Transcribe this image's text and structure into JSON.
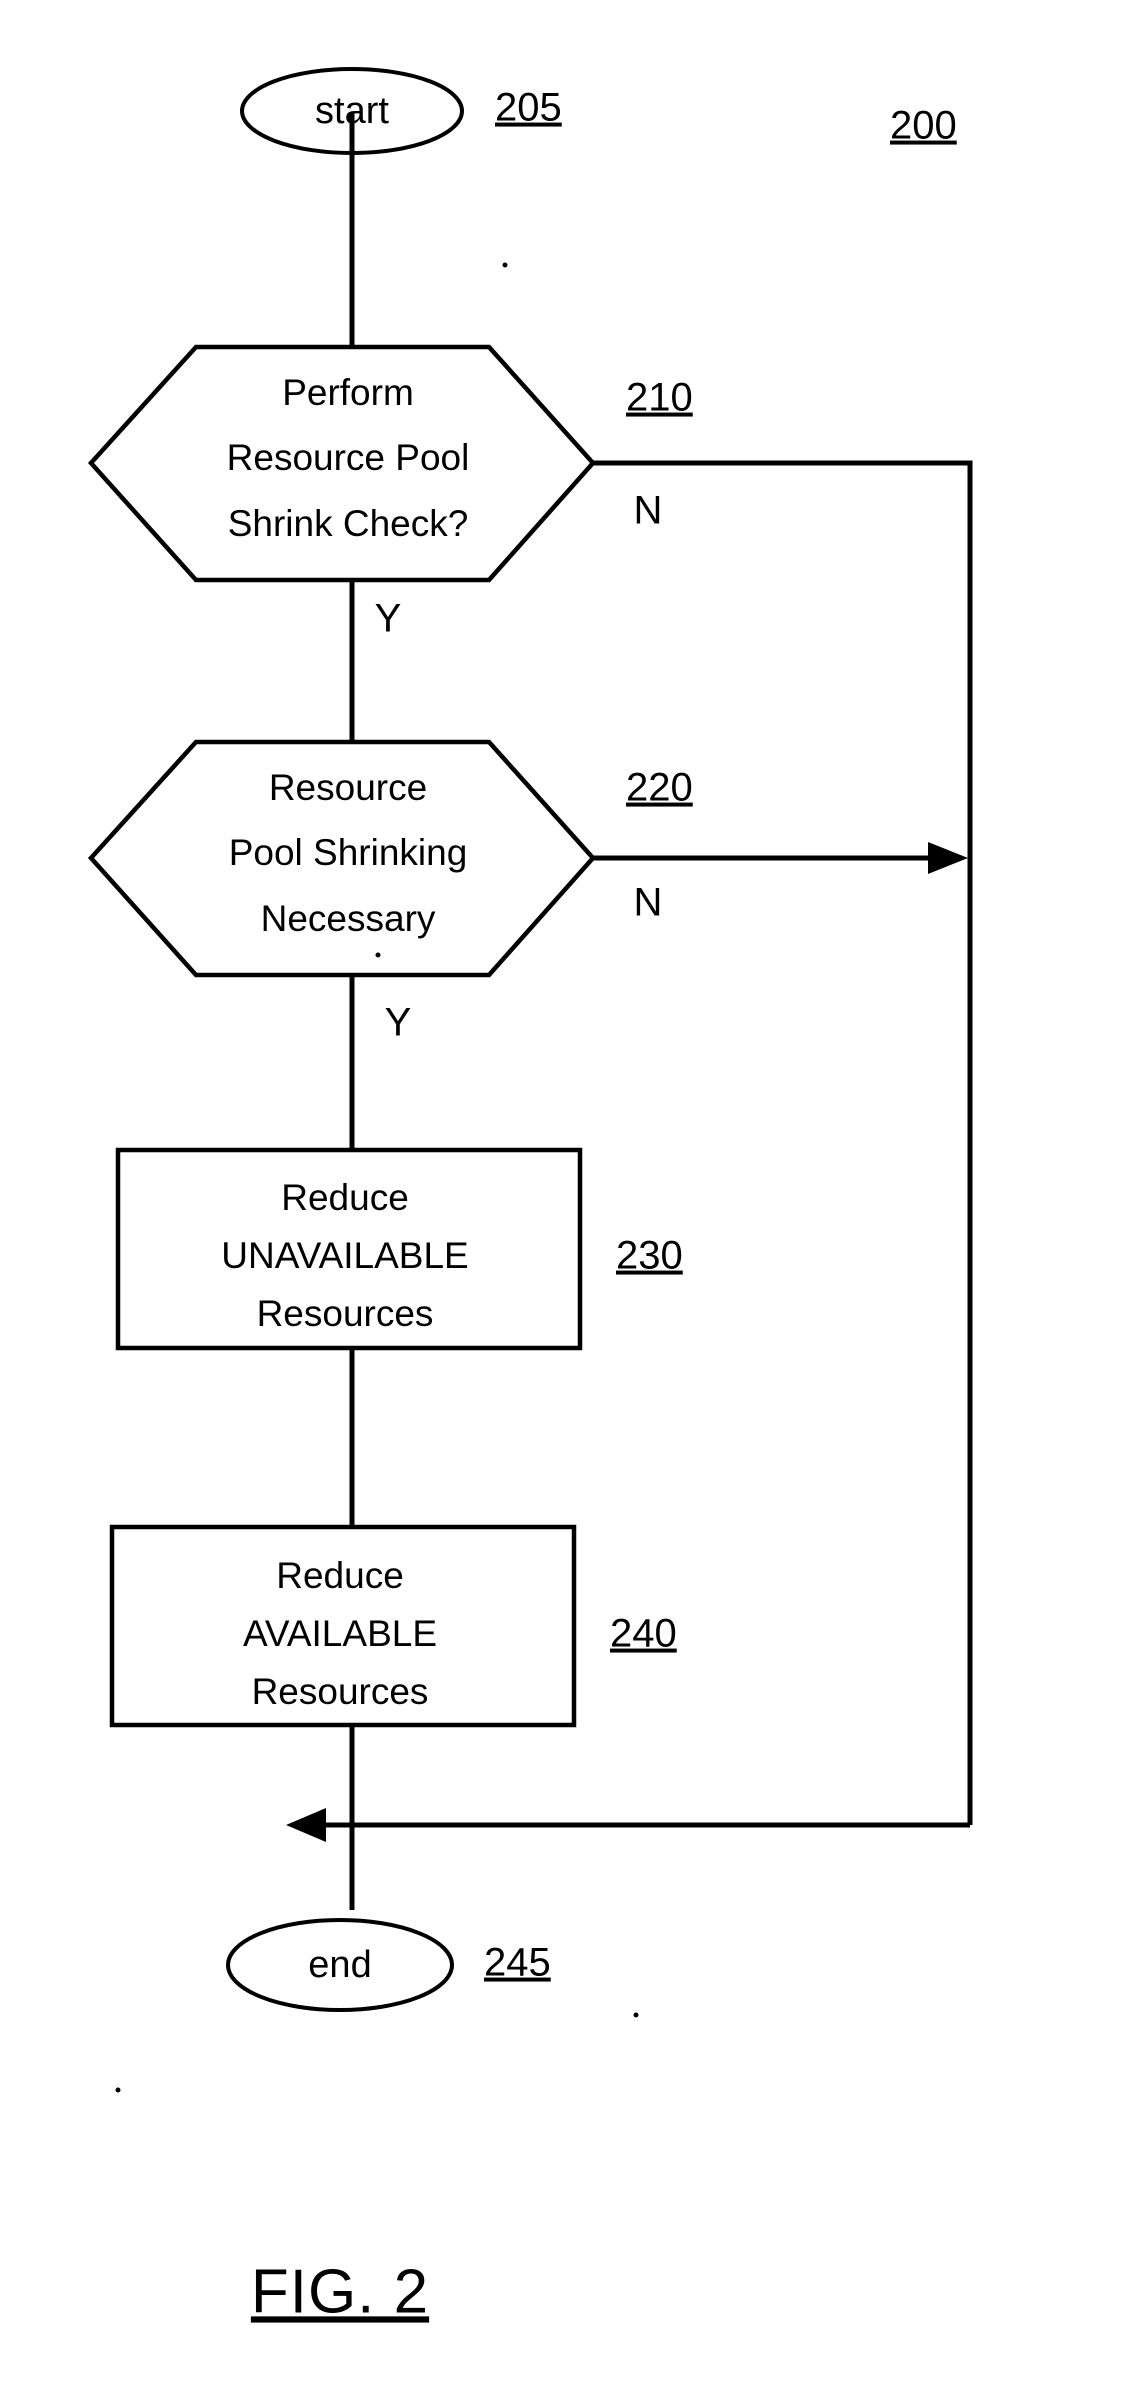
{
  "figure": {
    "caption": "FIG. 2",
    "diagram_ref": "200"
  },
  "nodes": {
    "start": {
      "label": "start",
      "ref": "205",
      "shape": "ellipse"
    },
    "decision_210": {
      "line1": "Perform",
      "line2": "Resource Pool",
      "line3": "Shrink Check?",
      "ref": "210",
      "shape": "hexagon",
      "yes_label": "Y",
      "no_label": "N"
    },
    "decision_220": {
      "line1": "Resource",
      "line2": "Pool Shrinking",
      "line3": "Necessary",
      "ref": "220",
      "shape": "hexagon",
      "yes_label": "Y",
      "no_label": "N"
    },
    "process_230": {
      "line1": "Reduce",
      "line2": "UNAVAILABLE",
      "line3": "Resources",
      "ref": "230",
      "shape": "rectangle"
    },
    "process_240": {
      "line1": "Reduce",
      "line2": "AVAILABLE",
      "line3": "Resources",
      "ref": "240",
      "shape": "rectangle"
    },
    "end": {
      "label": "end",
      "ref": "245",
      "shape": "ellipse"
    }
  },
  "colors": {
    "ink": "#000000",
    "paper": "#ffffff"
  }
}
